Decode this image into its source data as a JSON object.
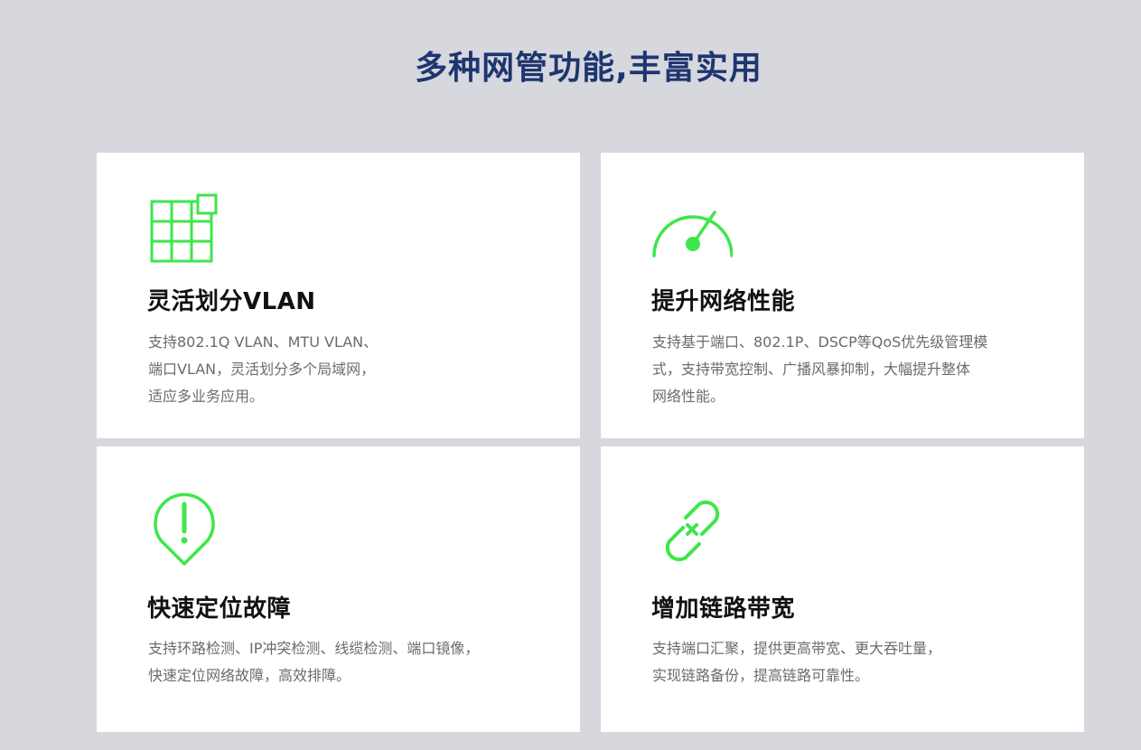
{
  "section": {
    "title": "多种网管功能,丰富实用"
  },
  "colors": {
    "accent": "#3ee64a",
    "title": "#1e3570",
    "background": "#d6d8de"
  },
  "cards": [
    {
      "icon": "grid-icon",
      "title": "灵活划分VLAN",
      "lines": [
        "支持802.1Q VLAN、MTU VLAN、",
        "端口VLAN，灵活划分多个局域网，",
        "适应多业务应用。"
      ]
    },
    {
      "icon": "speedometer-icon",
      "title": "提升网络性能",
      "lines": [
        "支持基于端口、802.1P、DSCP等QoS优先级管理模",
        "式，支持带宽控制、广播风暴抑制，大幅提升整体",
        "网络性能。"
      ]
    },
    {
      "icon": "alert-pin-icon",
      "title": "快速定位故障",
      "lines": [
        "支持环路检测、IP冲突检测、线缆检测、端口镜像，",
        "快速定位网络故障，高效排障。"
      ]
    },
    {
      "icon": "broken-link-icon",
      "title": "增加链路带宽",
      "lines": [
        "支持端口汇聚，提供更高带宽、更大吞吐量，",
        "实现链路备份，提高链路可靠性。"
      ]
    }
  ]
}
